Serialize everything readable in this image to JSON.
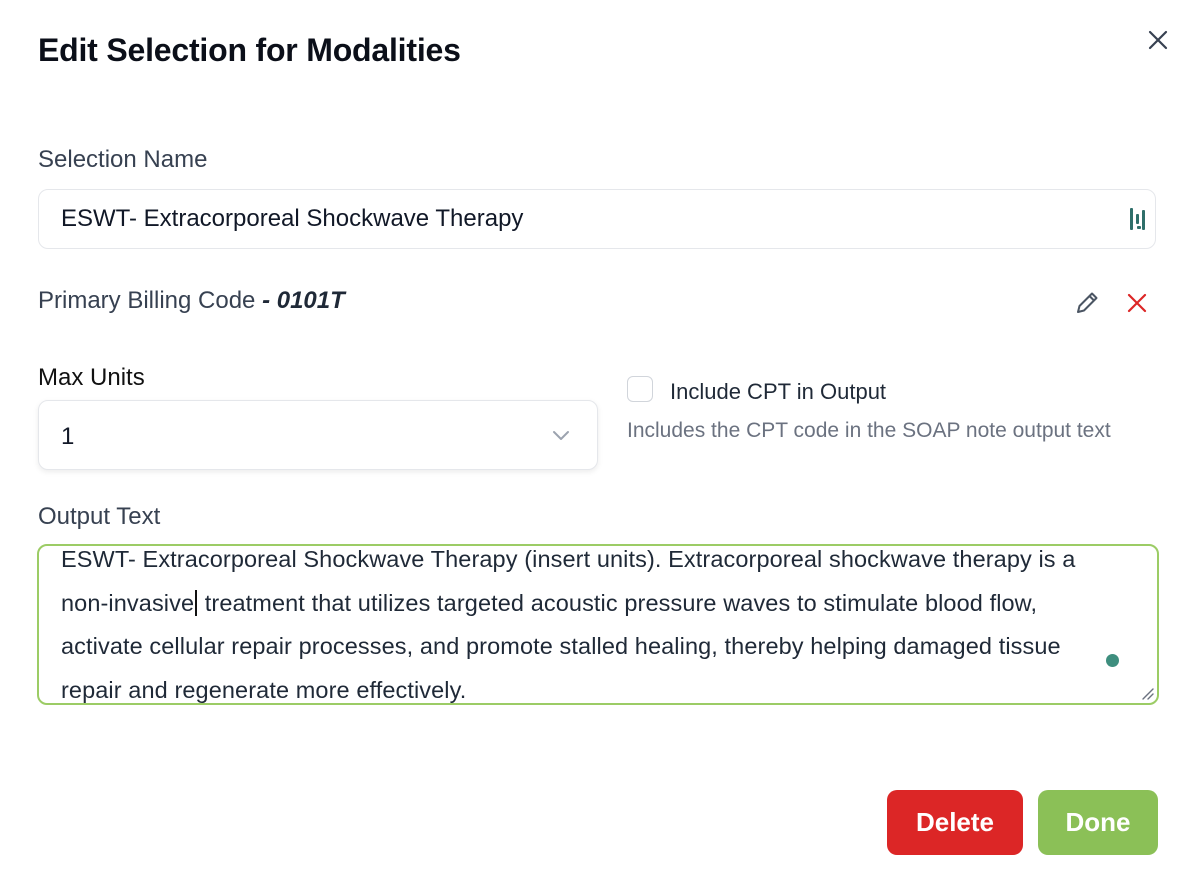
{
  "dialog": {
    "title": "Edit Selection for Modalities",
    "close_icon": "close-icon"
  },
  "selection_name": {
    "label": "Selection Name",
    "value": "ESWT- Extracorporeal Shockwave Therapy",
    "extension_icon": "form-helper-extension-icon"
  },
  "billing": {
    "label": "Primary Billing Code",
    "separator": " - ",
    "code": "0101T",
    "edit_icon": "pencil-icon",
    "remove_icon": "close-icon",
    "remove_color": "#dc2626"
  },
  "max_units": {
    "label": "Max Units",
    "value": "1",
    "icon": "chevron-down-icon"
  },
  "include_cpt": {
    "label": "Include CPT in Output",
    "checked": false,
    "help": "Includes the CPT code in the SOAP note output text"
  },
  "output_text": {
    "label": "Output Text",
    "before_caret": "ESWT- Extracorporeal Shockwave Therapy (insert units). Extracorporeal shockwave therapy is a non-invasive",
    "after_caret": " treatment that utilizes targeted acoustic pressure waves to stimulate blood flow, activate cellular repair processes, and promote stalled healing, thereby helping damaged tissue repair and regenerate more effectively.",
    "focus_color": "#9ccc65"
  },
  "actions": {
    "delete_label": "Delete",
    "done_label": "Done",
    "delete_color": "#dc2626",
    "done_color": "#8bc057"
  }
}
